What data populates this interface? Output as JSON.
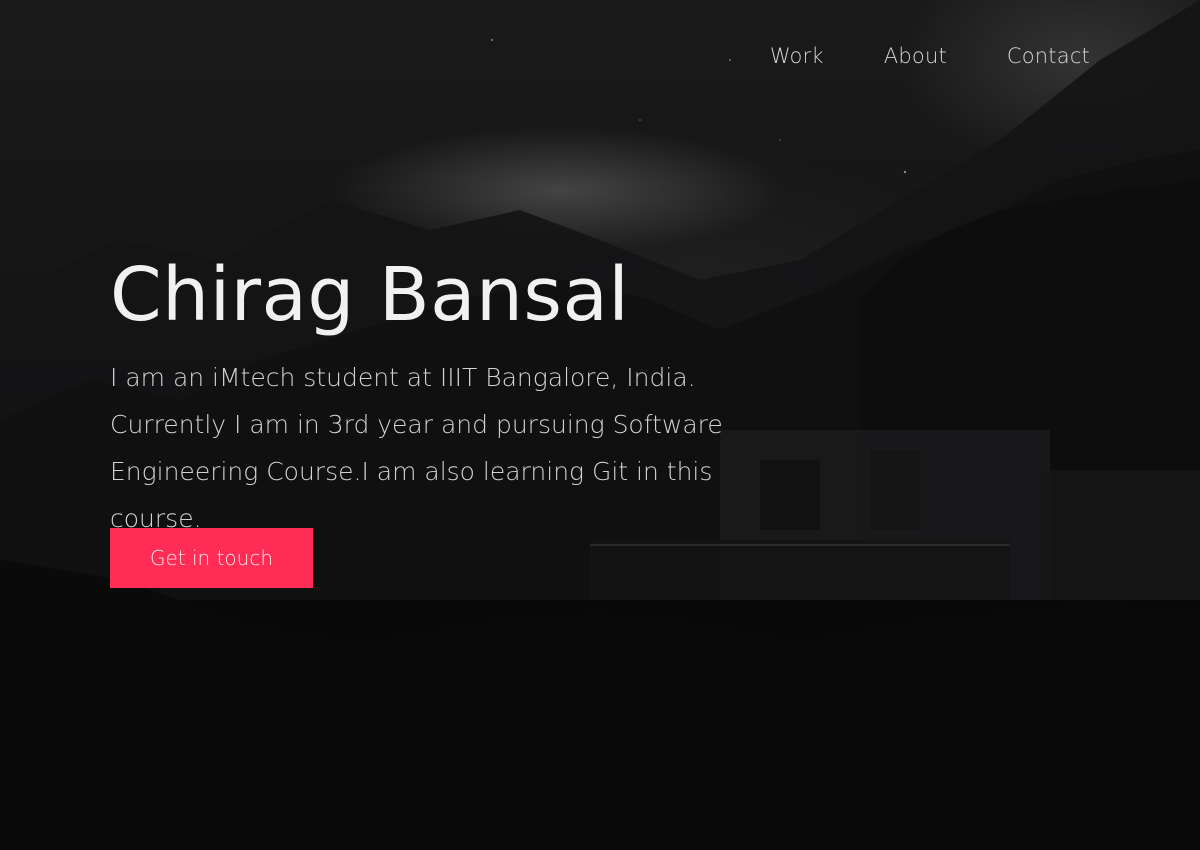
{
  "nav": {
    "items": [
      {
        "label": "Work"
      },
      {
        "label": "About"
      },
      {
        "label": "Contact"
      }
    ]
  },
  "hero": {
    "name": "Chirag Bansal",
    "bio": "I am an iMtech student at IIIT Bangalore, India. Currently I am in 3rd year and pursuing Software Engineering Course.I am also learning Git in this course.",
    "cta_label": "Get in touch",
    "accent_color": "#ff2d55"
  }
}
